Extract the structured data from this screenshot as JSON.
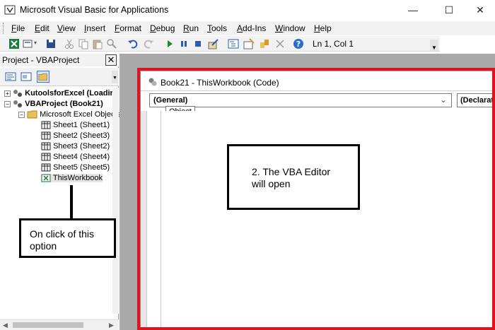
{
  "window": {
    "title": "Microsoft Visual Basic for Applications",
    "minimize": "—",
    "maximize": "☐",
    "close": "✕"
  },
  "menu": [
    "File",
    "Edit",
    "View",
    "Insert",
    "Format",
    "Debug",
    "Run",
    "Tools",
    "Add-Ins",
    "Window",
    "Help"
  ],
  "toolbar": {
    "position": "Ln 1, Col 1",
    "icons": [
      "excel-icon",
      "insert-module-icon",
      "save-icon",
      "cut-icon",
      "copy-icon",
      "paste-icon",
      "find-icon",
      "undo-icon",
      "redo-icon",
      "run-icon",
      "break-icon",
      "reset-icon",
      "design-mode-icon",
      "project-explorer-icon",
      "properties-icon",
      "object-browser-icon",
      "toolbox-icon",
      "help-icon"
    ]
  },
  "project": {
    "title": "Project - VBAProject",
    "close": "✕",
    "tree": [
      {
        "label": "KutoolsforExcel (Loadin",
        "bold": true
      },
      {
        "label": "VBAProject (Book21)",
        "bold": true
      },
      {
        "label": "Microsoft Excel Objects",
        "bold": false
      },
      {
        "label": "Sheet1 (Sheet1)",
        "bold": false
      },
      {
        "label": "Sheet2 (Sheet3)",
        "bold": false
      },
      {
        "label": "Sheet3 (Sheet2)",
        "bold": false
      },
      {
        "label": "Sheet4 (Sheet4)",
        "bold": false
      },
      {
        "label": "Sheet5 (Sheet5)",
        "bold": false
      },
      {
        "label": "ThisWorkbook",
        "bold": false
      }
    ]
  },
  "annotations": {
    "left": "On click of this option",
    "right": "2. The VBA Editor will open"
  },
  "code_window": {
    "title": "Book21 - ThisWorkbook (Code)",
    "object_value": "(General)",
    "procedure_value": "(Declarati",
    "tooltip": "Object"
  },
  "colors": {
    "highlight_frame": "#e0141e"
  }
}
